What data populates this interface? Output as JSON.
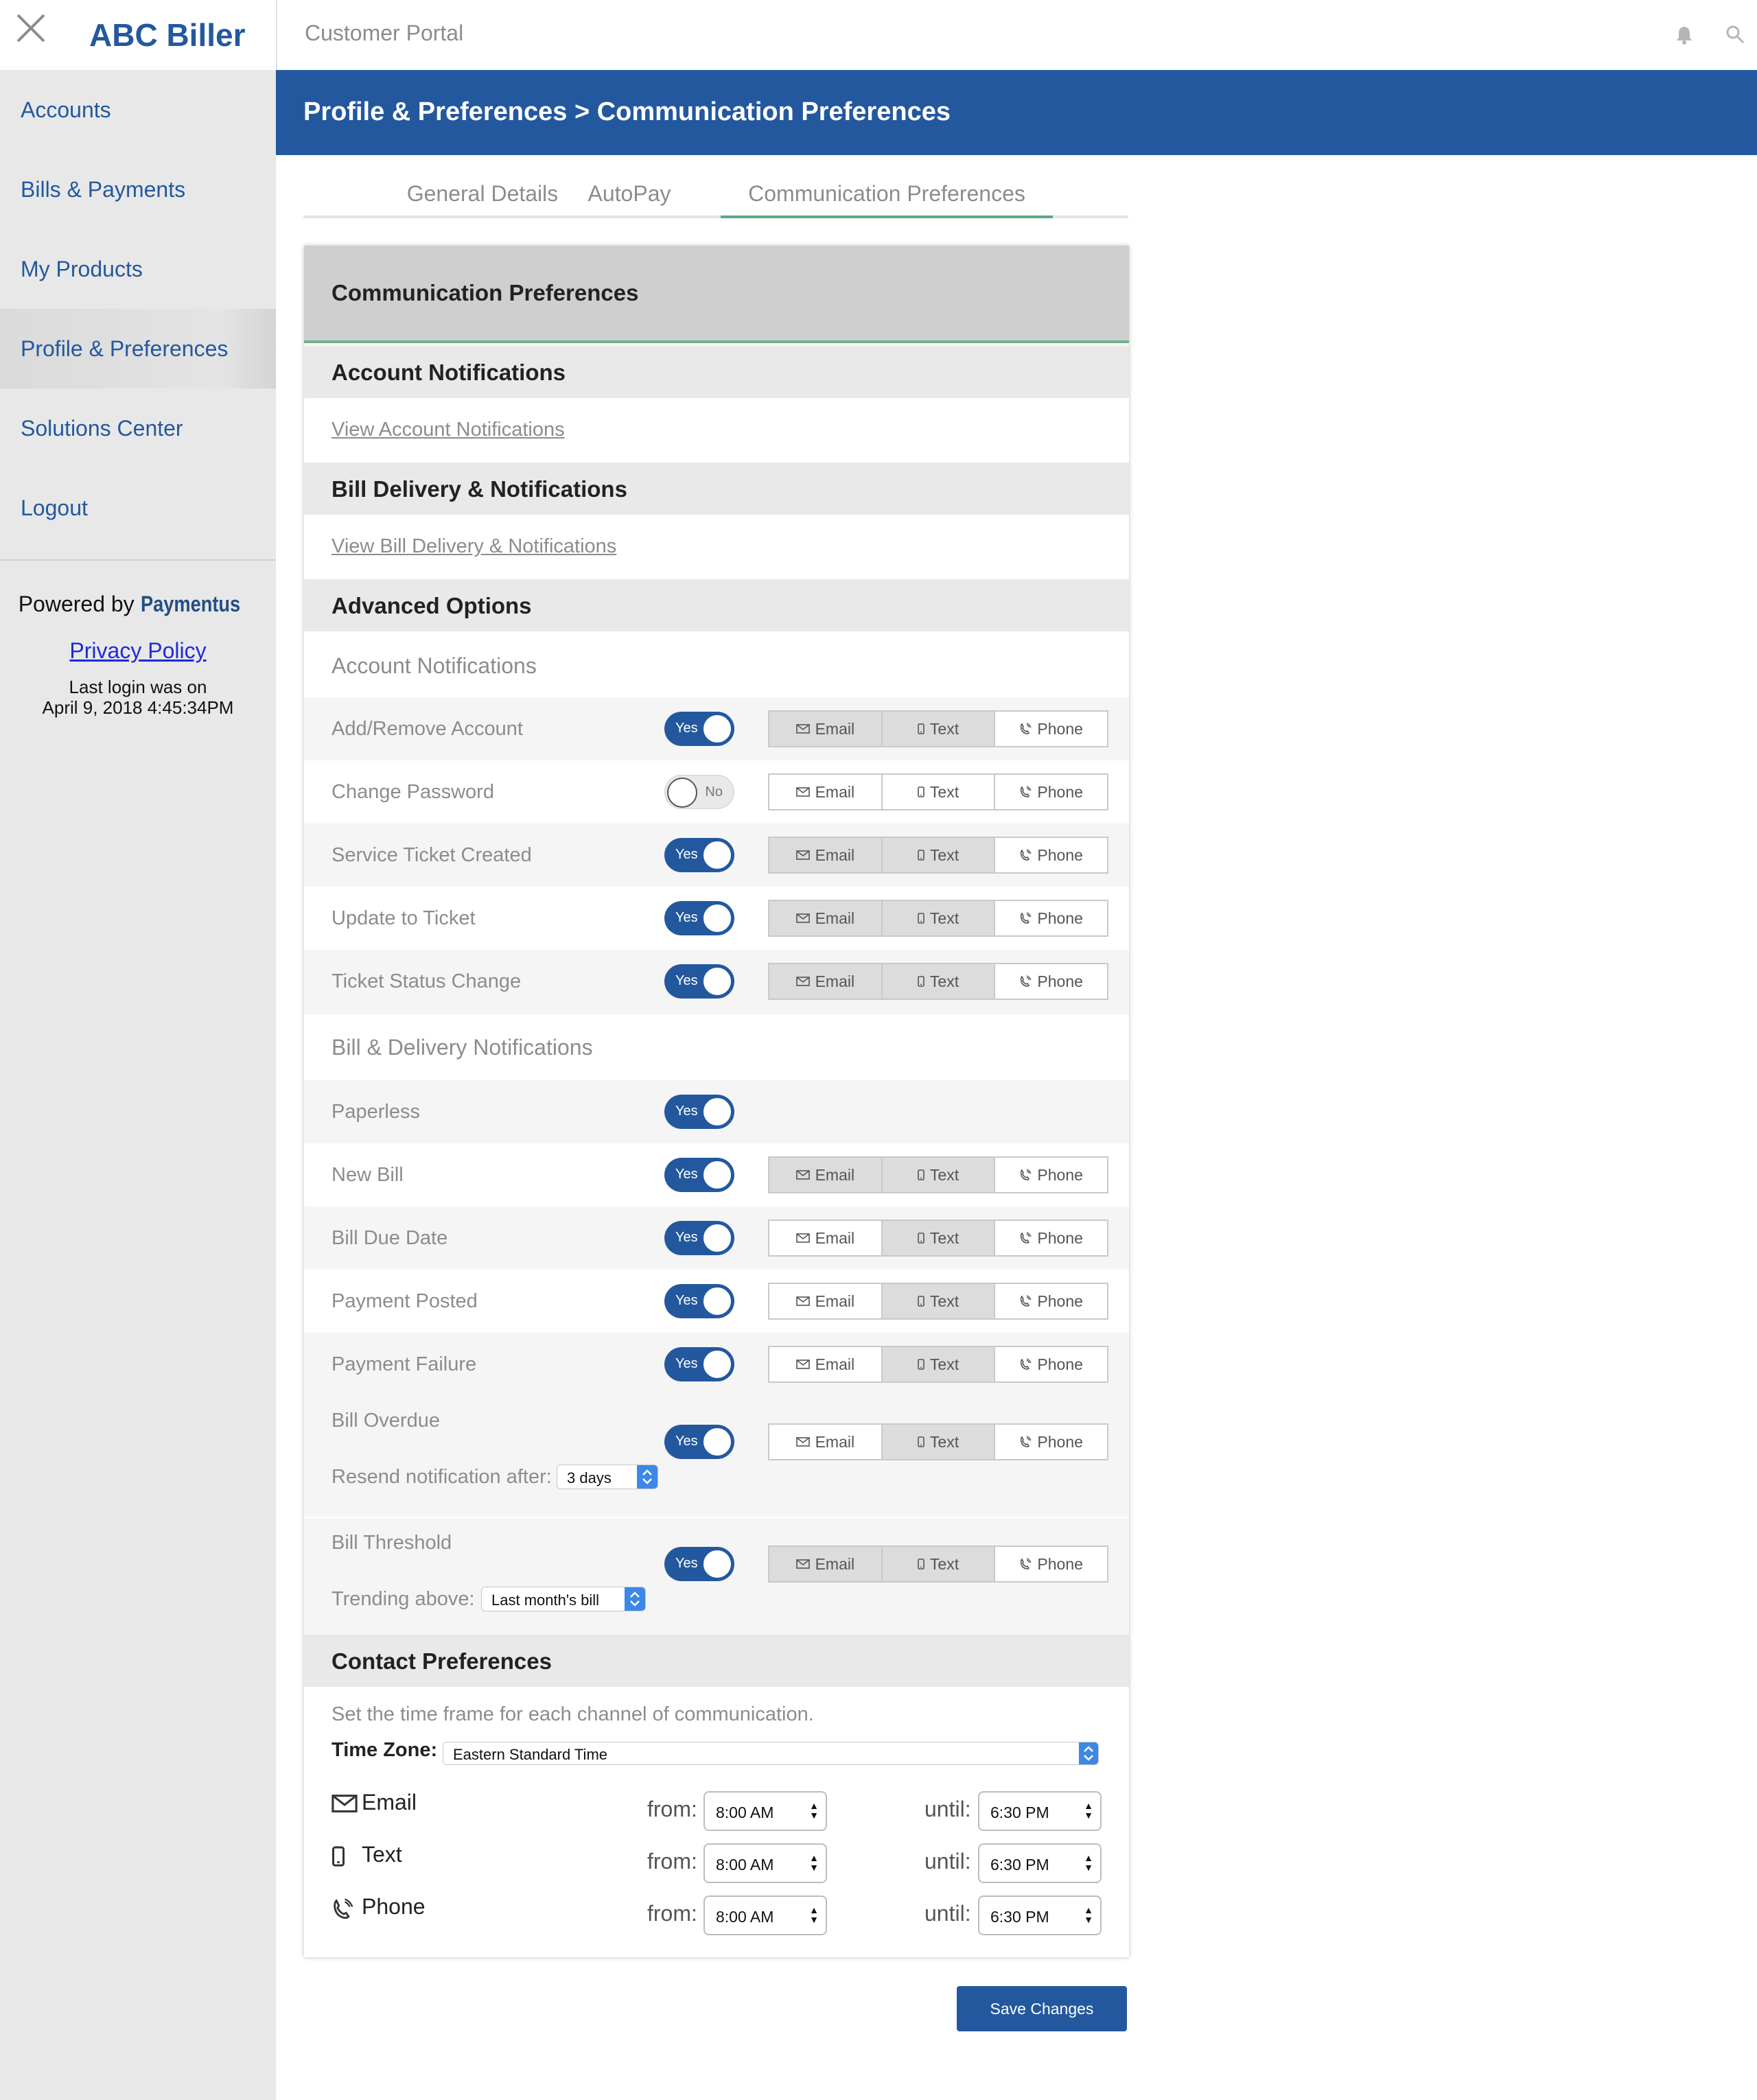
{
  "sidebar": {
    "brand": "ABC Biller",
    "nav": [
      "Accounts",
      "Bills & Payments",
      "My Products",
      "Profile & Preferences",
      "Solutions Center",
      "Logout"
    ],
    "active_index": 3,
    "powered_prefix": "Powered by",
    "powered_brand": "Paymentus",
    "privacy": "Privacy Policy",
    "last_login_line1": "Last login was on",
    "last_login_line2": "April 9, 2018 4:45:34PM"
  },
  "topbar": {
    "title": "Customer Portal"
  },
  "page": {
    "heading": "Profile & Preferences > Communication Preferences"
  },
  "tabs": [
    "General Details",
    "AutoPay",
    "Communication Preferences"
  ],
  "active_tab": 2,
  "card": {
    "title": "Communication Preferences",
    "account_notifications": {
      "title": "Account Notifications",
      "link": "View Account Notifications"
    },
    "bill_delivery": {
      "title": "Bill Delivery & Notifications",
      "link": "View Bill Delivery & Notifications"
    },
    "advanced": {
      "title": "Advanced Options",
      "group1_title": "Account Notifications",
      "group2_title": "Bill & Delivery Notifications",
      "channel_labels": {
        "email": "Email",
        "text": "Text",
        "phone": "Phone"
      },
      "yes_label": "Yes",
      "no_label": "No",
      "account_rows": [
        {
          "label": "Add/Remove Account",
          "enabled": true,
          "email": true,
          "text": true,
          "phone": false
        },
        {
          "label": "Change Password",
          "enabled": false,
          "email": false,
          "text": false,
          "phone": false
        },
        {
          "label": "Service Ticket Created",
          "enabled": true,
          "email": true,
          "text": true,
          "phone": false
        },
        {
          "label": "Update to Ticket",
          "enabled": true,
          "email": true,
          "text": true,
          "phone": false
        },
        {
          "label": "Ticket Status Change",
          "enabled": true,
          "email": true,
          "text": true,
          "phone": false
        }
      ],
      "paperless": {
        "label": "Paperless",
        "enabled": true
      },
      "bill_rows": [
        {
          "label": "New Bill",
          "enabled": true,
          "email": true,
          "text": true,
          "phone": false
        },
        {
          "label": "Bill Due Date",
          "enabled": true,
          "email": false,
          "text": true,
          "phone": false
        },
        {
          "label": "Payment Posted",
          "enabled": true,
          "email": false,
          "text": true,
          "phone": false
        },
        {
          "label": "Payment Failure",
          "enabled": true,
          "email": false,
          "text": true,
          "phone": false
        }
      ],
      "bill_overdue": {
        "label": "Bill Overdue",
        "enabled": true,
        "email": false,
        "text": true,
        "phone": false,
        "resend_label": "Resend notification after:",
        "resend_value": "3 days"
      },
      "bill_threshold": {
        "label": "Bill Threshold",
        "enabled": true,
        "email": true,
        "text": true,
        "phone": false,
        "trend_label": "Trending above:",
        "trend_value": "Last month's bill"
      }
    },
    "contact": {
      "title": "Contact Preferences",
      "description": "Set the time frame for each channel of communication.",
      "timezone_label": "Time Zone:",
      "timezone_value": "Eastern Standard Time",
      "from_label": "from:",
      "until_label": "until:",
      "channels": [
        {
          "name": "Email",
          "from": "8:00 AM",
          "until": "6:30 PM"
        },
        {
          "name": "Text",
          "from": "8:00 AM",
          "until": "6:30 PM"
        },
        {
          "name": "Phone",
          "from": "8:00 AM",
          "until": "6:30 PM"
        }
      ]
    }
  },
  "save_label": "Save Changes",
  "icons": {
    "close": "close-icon",
    "bell": "bell-icon",
    "search": "search-icon",
    "email": "envelope-icon",
    "text": "mobile-icon",
    "phone": "phone-icon"
  },
  "colors": {
    "brand_blue": "#23589f",
    "accent_green": "#6fb28b",
    "select_blue": "#3c88e6"
  }
}
